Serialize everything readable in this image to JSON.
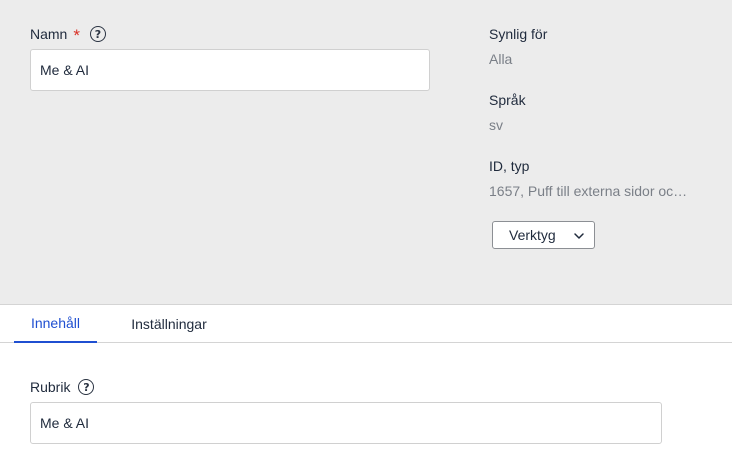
{
  "header": {
    "name_label": "Namn",
    "required_marker": "*",
    "name_value": "Me & AI",
    "help_glyph": "?"
  },
  "meta": {
    "visible_for_label": "Synlig för",
    "visible_for_value": "Alla",
    "language_label": "Språk",
    "language_value": "sv",
    "id_type_label": "ID, typ",
    "id_type_value": "1657, Puff till externa sidor oc…"
  },
  "toolbar": {
    "tools_label": "Verktyg",
    "tools_icon": "chevron-down-icon"
  },
  "tabs": [
    {
      "label": "Innehåll",
      "active": true
    },
    {
      "label": "Inställningar",
      "active": false
    }
  ],
  "content": {
    "heading_label": "Rubrik",
    "heading_value": "Me & AI"
  },
  "colors": {
    "accent": "#1f4fd1",
    "required": "#d93025",
    "panel_bg": "#ececec"
  }
}
